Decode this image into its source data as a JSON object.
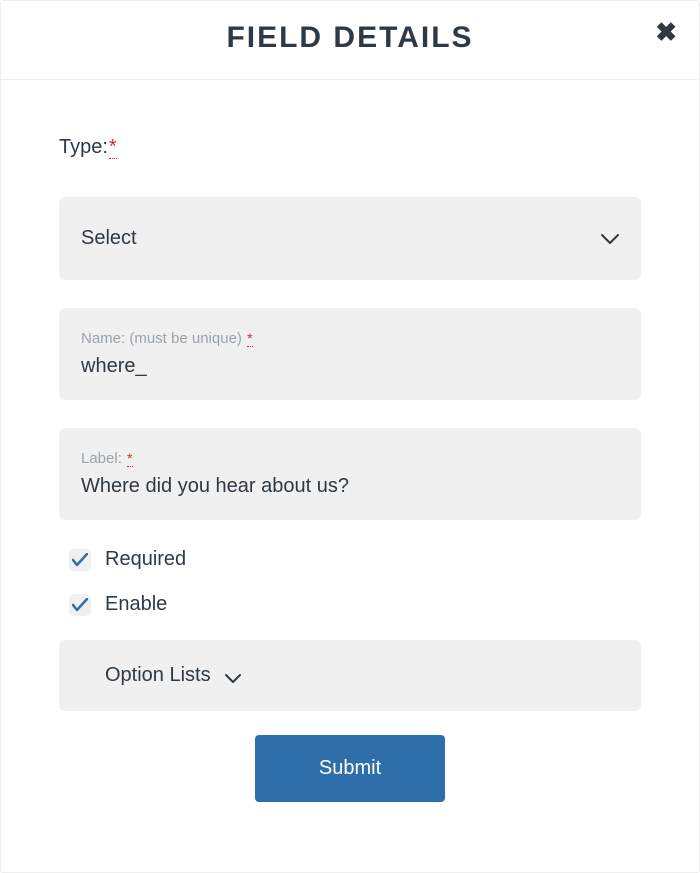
{
  "header": {
    "title": "FIELD DETAILS"
  },
  "type": {
    "label": "Type:",
    "required_marker": "*",
    "selected": "Select"
  },
  "name_field": {
    "label": "Name: (must be unique)",
    "required_marker": "*",
    "value": "where_"
  },
  "label_field": {
    "label": "Label:",
    "required_marker": "*",
    "value": "Where did you hear about us?"
  },
  "checkboxes": {
    "required": {
      "label": "Required",
      "checked": true
    },
    "enable": {
      "label": "Enable",
      "checked": true
    }
  },
  "option_lists": {
    "label": "Option Lists"
  },
  "submit": {
    "label": "Submit"
  }
}
